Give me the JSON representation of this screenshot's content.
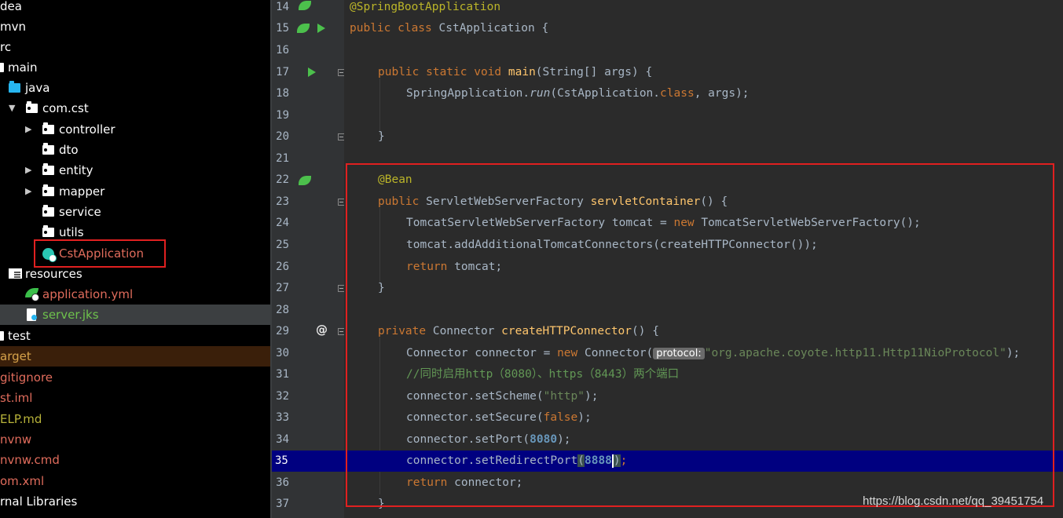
{
  "project_tree": {
    "items": [
      {
        "label": "dea"
      },
      {
        "label": "mvn"
      },
      {
        "label": "rc"
      },
      {
        "label": "main"
      },
      {
        "label": "java"
      },
      {
        "label": "com.cst"
      },
      {
        "label": "controller"
      },
      {
        "label": "dto"
      },
      {
        "label": "entity"
      },
      {
        "label": "mapper"
      },
      {
        "label": "service"
      },
      {
        "label": "utils"
      },
      {
        "label": "CstApplication"
      },
      {
        "label": "resources"
      },
      {
        "label": "application.yml"
      },
      {
        "label": "server.jks"
      },
      {
        "label": "test"
      },
      {
        "label": "arget"
      },
      {
        "label": "gitignore"
      },
      {
        "label": "st.iml"
      },
      {
        "label": "ELP.md"
      },
      {
        "label": "nvnw"
      },
      {
        "label": "nvnw.cmd"
      },
      {
        "label": "om.xml"
      },
      {
        "label": "rnal Libraries"
      }
    ],
    "colors": {
      "selected_bg": "#3c3f41",
      "target_bg": "#3a1f0a",
      "ignored": "#e06c5c",
      "modified": "#b8b33a",
      "added": "#6ec24c"
    }
  },
  "editor": {
    "line_numbers": [
      "14",
      "15",
      "16",
      "17",
      "18",
      "19",
      "20",
      "21",
      "22",
      "23",
      "24",
      "25",
      "26",
      "27",
      "28",
      "29",
      "30",
      "31",
      "32",
      "33",
      "34",
      "35",
      "36",
      "37"
    ],
    "current_line": "35",
    "inlay_hint": "protocol:",
    "tokens": {
      "l14": "@SpringBootApplication",
      "l15a": "public class ",
      "l15b": "CstApplication {",
      "l17a": "public static void ",
      "l17b": "main",
      "l17c": "(String[] args) {",
      "l18a": "SpringApplication.",
      "l18b": "run",
      "l18c": "(CstApplication.",
      "l18d": "class",
      "l18e": ", args);",
      "l20": "}",
      "l22": "@Bean",
      "l23a": "public ",
      "l23b": "ServletWebServerFactory ",
      "l23c": "servletContainer",
      "l23d": "() {",
      "l24a": "TomcatServletWebServerFactory tomcat = ",
      "l24b": "new ",
      "l24c": "TomcatServletWebServerFactory();",
      "l25": "tomcat.addAdditionalTomcatConnectors(createHTTPConnector());",
      "l26a": "return ",
      "l26b": "tomcat;",
      "l27": "}",
      "l29a": "private ",
      "l29b": "Connector ",
      "l29c": "createHTTPConnector",
      "l29d": "() {",
      "l30a": "Connector connector = ",
      "l30b": "new ",
      "l30c": "Connector(",
      "l30d": "\"org.apache.coyote.http11.Http11NioProtocol\"",
      "l30e": ");",
      "l31": "//同时启用http（8080）、https（8443）两个端口",
      "l32a": "connector.setScheme(",
      "l32b": "\"http\"",
      "l32c": ");",
      "l33a": "connector.setSecure(",
      "l33b": "false",
      "l33c": ");",
      "l34a": "connector.setPort(",
      "l34b": "8080",
      "l34c": ");",
      "l35a": "connector.setRedirectPort",
      "l35b": "(",
      "l35c": "8888",
      "l35d": ")",
      "l35e": ";",
      "l36a": "return ",
      "l36b": "connector;",
      "l37": "}"
    }
  },
  "watermark": "https://blog.csdn.net/qq_39451754"
}
